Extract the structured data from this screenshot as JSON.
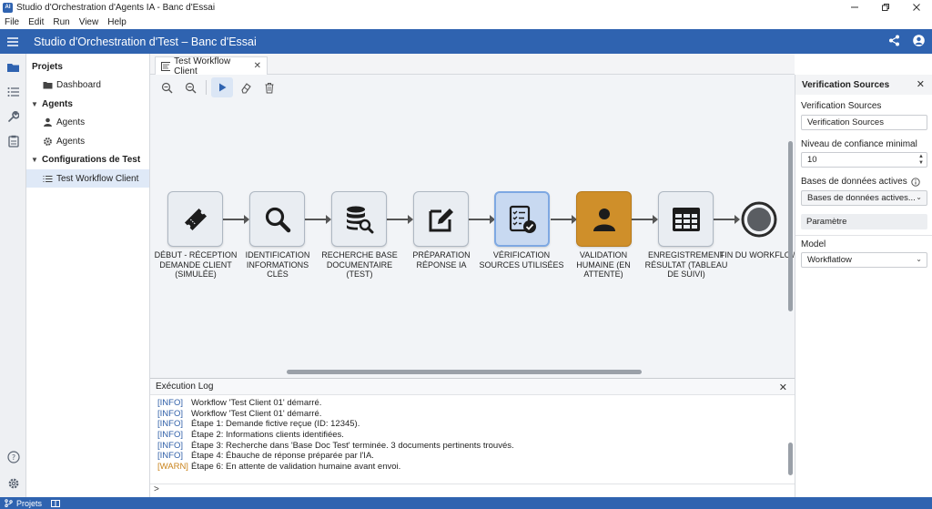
{
  "window": {
    "title": "Studio d'Orchestration d'Agents IA - Banc d'Essai",
    "logo_text": "AI"
  },
  "menu": [
    "File",
    "Edit",
    "Run",
    "View",
    "Help"
  ],
  "header": {
    "title": "Studio d'Orchestration d'Test – Banc d'Essai"
  },
  "sidebar": {
    "sections": [
      {
        "label": "Projets"
      },
      {
        "label": "Agents"
      },
      {
        "label": "Configurations de Test"
      }
    ],
    "items": {
      "dashboard": "Dashboard",
      "agents_1": "Agents",
      "agents_2": "Agents",
      "test_workflow": "Test Workflow Client"
    }
  },
  "tab": {
    "label": "Test Workflow Client"
  },
  "workflow": {
    "nodes": [
      {
        "label": "Début - Réception Demande Client (Simulée)",
        "icon": "ticket-icon",
        "state": "normal"
      },
      {
        "label": "Identification Informations Clés",
        "icon": "search-icon",
        "state": "normal"
      },
      {
        "label": "Recherche Base Documentaire (Test)",
        "icon": "database-search-icon",
        "state": "normal"
      },
      {
        "label": "Préparation Réponse IA",
        "icon": "edit-icon",
        "state": "normal"
      },
      {
        "label": "Vérification Sources Utilisées",
        "icon": "checklist-icon",
        "state": "selected"
      },
      {
        "label": "Validation Humaine (En Attente)",
        "icon": "person-icon",
        "state": "pending"
      },
      {
        "label": "Enregistrement Résultat (Tableau de Suivi)",
        "icon": "table-icon",
        "state": "normal"
      },
      {
        "label": "Fin du Workflow",
        "icon": "end-circle-icon",
        "state": "end"
      }
    ]
  },
  "log": {
    "title": "Exécution Log",
    "prompt": ">",
    "lines": [
      {
        "level": "[INFO]",
        "text": "Workflow 'Test Client 01' démarré."
      },
      {
        "level": "[INFO]",
        "text": "Workflow 'Test Client 01' démarré."
      },
      {
        "level": "[INFO]",
        "text": "Étape 1: Demande fictive reçue (ID: 12345)."
      },
      {
        "level": "[INFO]",
        "text": "Étape 2: Informations clients identifiées."
      },
      {
        "level": "[INFO]",
        "text": "Étape 3: Recherche dans 'Base Doc Test' terminée. 3 documents pertinents trouvés."
      },
      {
        "level": "[INFO]",
        "text": "Étape 4: Ébauche de réponse préparée par l'IA."
      },
      {
        "level": "[WARN]",
        "text": "Étape 6: En attente de validation humaine avant envoi."
      }
    ]
  },
  "properties": {
    "title": "Verification Sources",
    "name_label": "Verification Sources",
    "name_value": "Verification Sources",
    "confidence_label": "Niveau de confiance minimal",
    "confidence_value": "10",
    "databases_label": "Bases de données actives",
    "databases_value": "Bases de données actives...",
    "param_button": "Paramètre",
    "model_label": "Model",
    "model_value": "Workflatlow"
  },
  "statusbar": {
    "label": "Projets"
  },
  "colors": {
    "brand": "#2f63b0",
    "selected_node": "#c8d9f1",
    "pending_node": "#cf8f2a",
    "info": "#2f5fa8",
    "warn": "#c9831b"
  }
}
